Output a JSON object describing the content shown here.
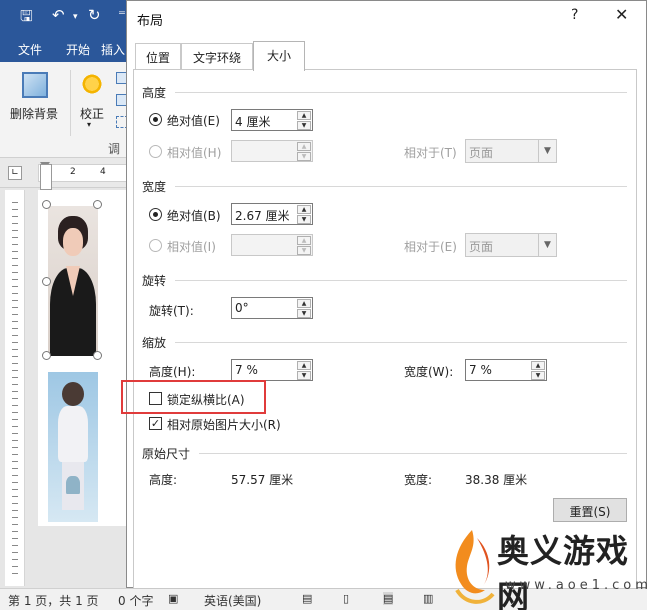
{
  "word": {
    "tabs": [
      "文件",
      "开始",
      "插入"
    ],
    "ribbon": {
      "remove_bg": "删除背景",
      "correct": "校正",
      "adjust_partial": "调整"
    },
    "ruler_numbers": [
      "2",
      "4"
    ],
    "status": {
      "page": "第 1 页，共 1 页",
      "words": "0 个字",
      "lang": "英语(美国)"
    }
  },
  "dialog": {
    "title": "布局",
    "help": "?",
    "close": "✕",
    "tabs": [
      "位置",
      "文字环绕",
      "大小"
    ],
    "active_tab": "大小",
    "height": {
      "section": "高度",
      "absolute_label": "绝对值(E)",
      "absolute_value": "4 厘米",
      "relative_label": "相对值(H)",
      "relative_to_label": "相对于(T)",
      "relative_to_value": "页面"
    },
    "width": {
      "section": "宽度",
      "absolute_label": "绝对值(B)",
      "absolute_value": "2.67 厘米",
      "relative_label": "相对值(I)",
      "relative_to_label": "相对于(E)",
      "relative_to_value": "页面"
    },
    "rotate": {
      "section": "旋转",
      "label": "旋转(T):",
      "value": "0°"
    },
    "scale": {
      "section": "缩放",
      "height_label": "高度(H):",
      "height_value": "7 %",
      "width_label": "宽度(W):",
      "width_value": "7 %",
      "lock_aspect_label": "锁定纵横比(A)",
      "relative_original_label": "相对原始图片大小(R)"
    },
    "original": {
      "section": "原始尺寸",
      "height_label": "高度:",
      "height_value": "57.57 厘米",
      "width_label": "宽度:",
      "width_value": "38.38 厘米"
    },
    "reset_button": "重置(S)"
  },
  "watermark": {
    "text": "奥义游戏网",
    "url": "www.aoe1.com"
  },
  "colors": {
    "word_blue": "#2b579a",
    "highlight_red": "#e03b3b"
  }
}
